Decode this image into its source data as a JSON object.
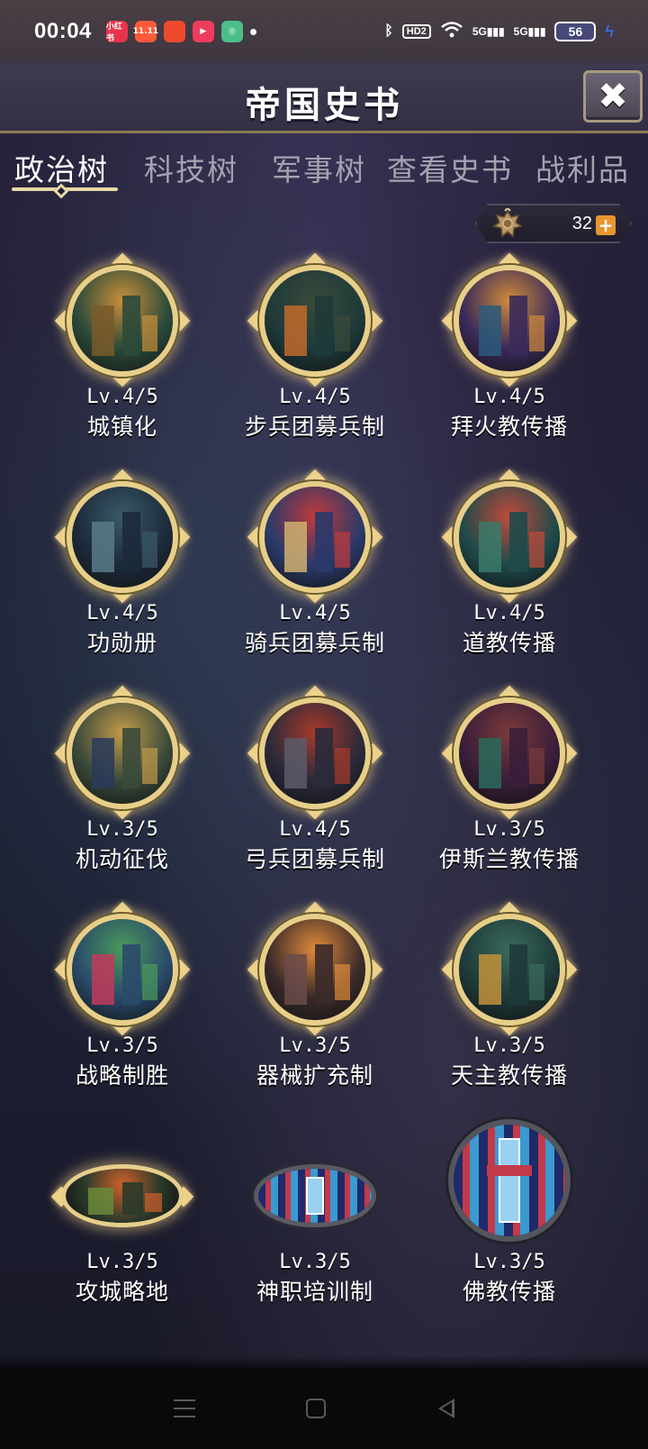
{
  "status_bar": {
    "time": "00:04",
    "apps": [
      {
        "name": "xiaohongshu-app-icon",
        "label": "小红书",
        "color": "#e8344a"
      },
      {
        "name": "taobao-app-icon",
        "label": "11.11",
        "color": "#ff5a3a"
      },
      {
        "name": "meituan-app-icon",
        "label": "",
        "color": "#f04a2e"
      },
      {
        "name": "video-app-icon",
        "label": "▶",
        "color": "#ef3c5c"
      },
      {
        "name": "green-app-icon",
        "label": "◎",
        "color": "#4bbf8a"
      }
    ],
    "hd_label": "HD2",
    "net1": "5G",
    "net2": "5G",
    "battery": "56"
  },
  "header": {
    "title": "帝国史书",
    "close_label": "✖"
  },
  "tabs": [
    {
      "label": "政治树",
      "active": true
    },
    {
      "label": "科技树",
      "active": false
    },
    {
      "label": "军事树",
      "active": false
    },
    {
      "label": "查看史书",
      "active": false
    },
    {
      "label": "战利品",
      "active": false
    }
  ],
  "currency": {
    "icon": "eagle-emblem-icon",
    "value": "32",
    "add_label": "+"
  },
  "policies": [
    {
      "level": "Lv.4/5",
      "name": "城镇化",
      "icon": "town-painting",
      "colors": [
        "#2b4a3a",
        "#c98f3a",
        "#7a5a2a"
      ],
      "frame": "circle"
    },
    {
      "level": "Lv.4/5",
      "name": "步兵团募兵制",
      "icon": "infantry-painting",
      "colors": [
        "#1e3a3a",
        "#3a4a3a",
        "#c26a2a"
      ],
      "frame": "circle"
    },
    {
      "level": "Lv.4/5",
      "name": "拜火教传播",
      "icon": "fire-temple-painting",
      "colors": [
        "#3a2a5a",
        "#d08a3a",
        "#2a5a7a"
      ],
      "frame": "circle"
    },
    {
      "level": "Lv.4/5",
      "name": "功勋册",
      "icon": "statue-painting",
      "colors": [
        "#1c2a3a",
        "#3a5a6a",
        "#5a7a8a"
      ],
      "frame": "circle"
    },
    {
      "level": "Lv.4/5",
      "name": "骑兵团募兵制",
      "icon": "cavalry-painting",
      "colors": [
        "#2a3a6a",
        "#c23a3a",
        "#d0b070"
      ],
      "frame": "circle"
    },
    {
      "level": "Lv.4/5",
      "name": "道教传播",
      "icon": "taoist-temple-painting",
      "colors": [
        "#1e4a4a",
        "#c24a3a",
        "#3a7a6a"
      ],
      "frame": "circle"
    },
    {
      "level": "Lv.3/5",
      "name": "机动征伐",
      "icon": "battle-painting",
      "colors": [
        "#3a4a3a",
        "#c29a4a",
        "#2a3a5a"
      ],
      "frame": "circle"
    },
    {
      "level": "Lv.4/5",
      "name": "弓兵团募兵制",
      "icon": "archer-painting",
      "colors": [
        "#2a2a3a",
        "#a83a2a",
        "#5a5a6a"
      ],
      "frame": "circle"
    },
    {
      "level": "Lv.3/5",
      "name": "伊斯兰教传播",
      "icon": "mosque-painting",
      "colors": [
        "#3a1e3a",
        "#7a3a3a",
        "#2a6a5a"
      ],
      "frame": "circle"
    },
    {
      "level": "Lv.3/5",
      "name": "战略制胜",
      "icon": "knight-painting",
      "colors": [
        "#2a4a6a",
        "#4a9a5a",
        "#c23a5a"
      ],
      "frame": "circle"
    },
    {
      "level": "Lv.3/5",
      "name": "器械扩充制",
      "icon": "siege-engine-painting",
      "colors": [
        "#3a2a2a",
        "#e08a3a",
        "#6a4a4a"
      ],
      "frame": "circle"
    },
    {
      "level": "Lv.3/5",
      "name": "天主教传播",
      "icon": "cathedral-painting",
      "colors": [
        "#1e3a3a",
        "#3a6a5a",
        "#c2903a"
      ],
      "frame": "circle"
    },
    {
      "level": "Lv.3/5",
      "name": "攻城略地",
      "icon": "siege-battle-painting",
      "colors": [
        "#2a3a2a",
        "#d0602a",
        "#6a8a3a"
      ],
      "frame": "oval"
    },
    {
      "level": "Lv.3/5",
      "name": "神职培训制",
      "icon": "stained-glass-sword-icon",
      "colors": [
        "#1e2a6a",
        "#c23a4a",
        "#3a9ad0"
      ],
      "frame": "oval-dark"
    },
    {
      "level": "Lv.3/5",
      "name": "佛教传播",
      "icon": "stained-glass-sword-icon",
      "colors": [
        "#1e2a6a",
        "#c23a4a",
        "#3a9ad0"
      ],
      "frame": "circle-dark"
    }
  ]
}
